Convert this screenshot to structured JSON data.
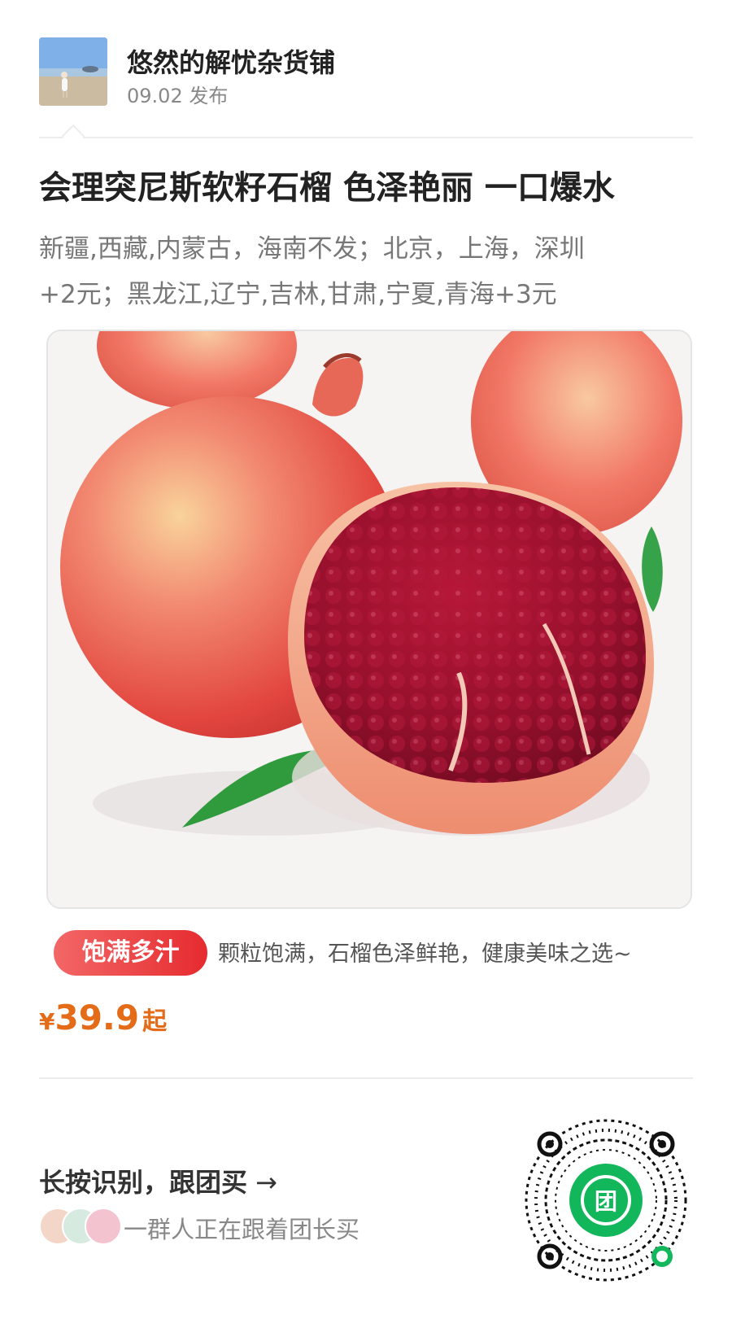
{
  "header": {
    "shop_name": "悠然的解忧杂货铺",
    "post_meta": "09.02 发布",
    "avatar_icon": "avatar-beach-photo"
  },
  "product": {
    "title": "会理突尼斯软籽石榴 色泽艳丽 一口爆水",
    "shipping_line1": "新疆,西藏,内蒙古，海南不发；北京，上海，深圳",
    "shipping_line2": "+2元；黑龙江,辽宁,吉林,甘肃,宁夏,青海+3元",
    "image_icon": "pomegranate-photo",
    "tag": "饱满多汁",
    "tag_description": "颗粒饱满，石榴色泽鲜艳，健康美味之选~",
    "price_currency": "¥",
    "price_value": "39.9",
    "price_suffix": "起"
  },
  "footer": {
    "cta_label": "长按识别，跟团买",
    "cta_icon": "arrow-right-icon",
    "buyers_text": "一群人正在跟着团长买",
    "qr_icon": "mini-program-qr-code",
    "qr_center_text": "团"
  },
  "colors": {
    "price": "#e46b17",
    "tag_start": "#f36767",
    "tag_end": "#e62b2f",
    "qr_green": "#12b75c"
  }
}
